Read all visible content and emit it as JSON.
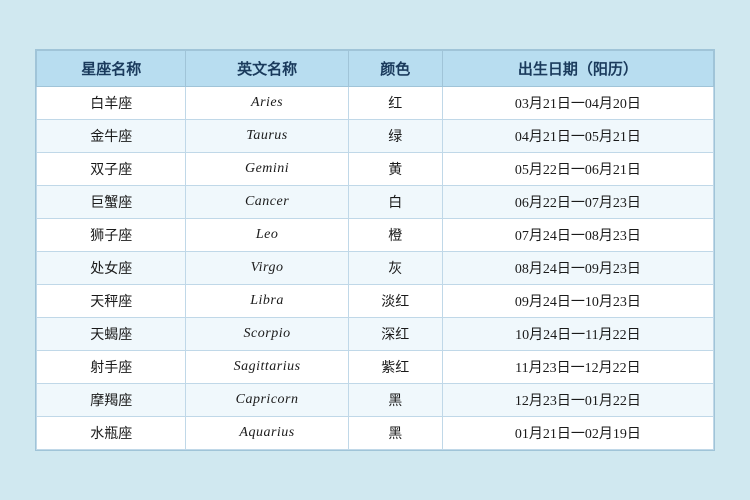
{
  "table": {
    "headers": [
      "星座名称",
      "英文名称",
      "颜色",
      "出生日期（阳历）"
    ],
    "rows": [
      {
        "chinese": "白羊座",
        "english": "Aries",
        "color": "红",
        "dates": "03月21日一04月20日"
      },
      {
        "chinese": "金牛座",
        "english": "Taurus",
        "color": "绿",
        "dates": "04月21日一05月21日"
      },
      {
        "chinese": "双子座",
        "english": "Gemini",
        "color": "黄",
        "dates": "05月22日一06月21日"
      },
      {
        "chinese": "巨蟹座",
        "english": "Cancer",
        "color": "白",
        "dates": "06月22日一07月23日"
      },
      {
        "chinese": "狮子座",
        "english": "Leo",
        "color": "橙",
        "dates": "07月24日一08月23日"
      },
      {
        "chinese": "处女座",
        "english": "Virgo",
        "color": "灰",
        "dates": "08月24日一09月23日"
      },
      {
        "chinese": "天秤座",
        "english": "Libra",
        "color": "淡红",
        "dates": "09月24日一10月23日"
      },
      {
        "chinese": "天蝎座",
        "english": "Scorpio",
        "color": "深红",
        "dates": "10月24日一11月22日"
      },
      {
        "chinese": "射手座",
        "english": "Sagittarius",
        "color": "紫红",
        "dates": "11月23日一12月22日"
      },
      {
        "chinese": "摩羯座",
        "english": "Capricorn",
        "color": "黑",
        "dates": "12月23日一01月22日"
      },
      {
        "chinese": "水瓶座",
        "english": "Aquarius",
        "color": "黑",
        "dates": "01月21日一02月19日"
      }
    ]
  }
}
